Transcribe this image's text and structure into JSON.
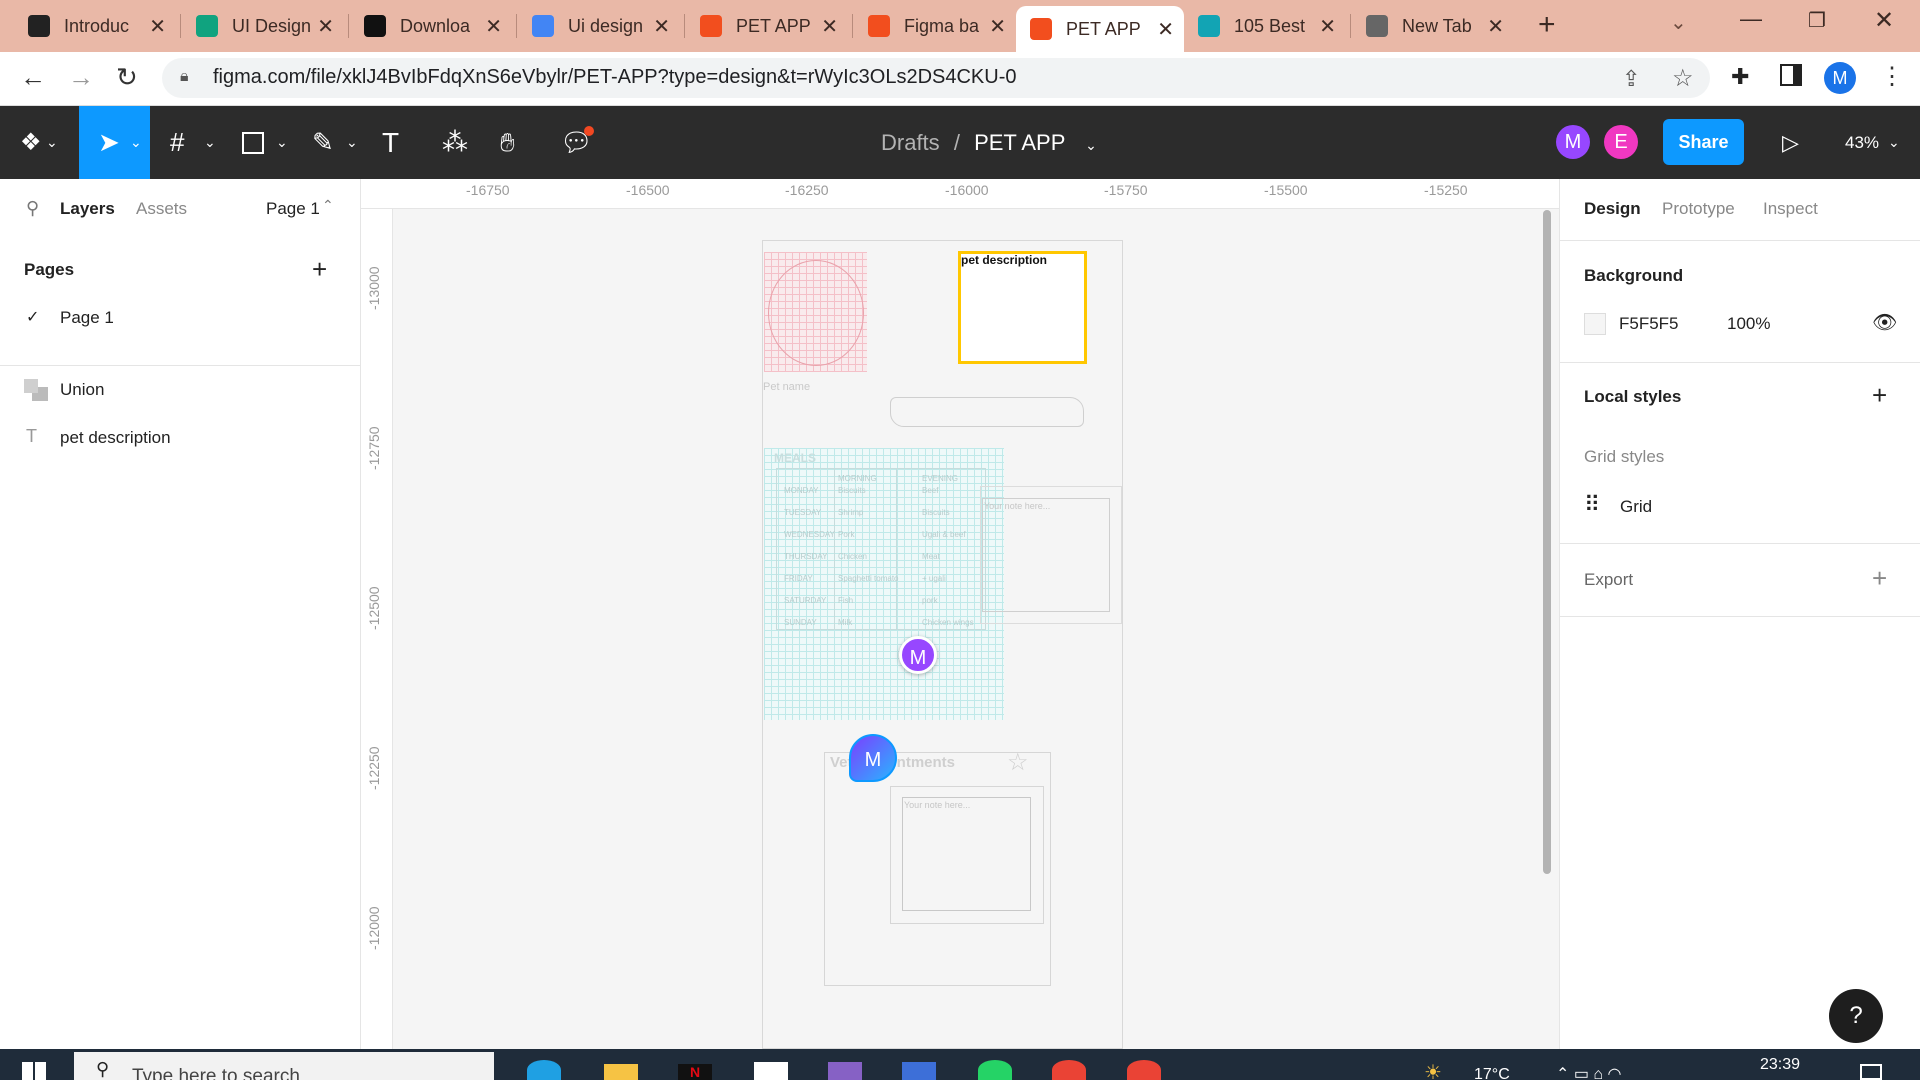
{
  "browser": {
    "tabs": [
      {
        "title": "Introduc",
        "color": "#222"
      },
      {
        "title": "UI Design",
        "color": "#10a37f"
      },
      {
        "title": "Downloa",
        "color": "#111"
      },
      {
        "title": "Ui design",
        "color": "#4285f4"
      },
      {
        "title": "PET APP",
        "color": "#f24e1e"
      },
      {
        "title": "Figma ba",
        "color": "#f24e1e"
      },
      {
        "title": "PET APP",
        "color": "#f24e1e"
      },
      {
        "title": "105 Best",
        "color": "#12a4b4"
      },
      {
        "title": "New Tab",
        "color": "#666"
      }
    ],
    "active_tab": 6,
    "new_tab": "+",
    "url": "figma.com/file/xklJ4BvIbFdqXnS6eVbylr/PET-APP?type=design&t=rWyIc3OLs2DS4CKU-0",
    "profile": "M"
  },
  "toolbar": {
    "breadcrumb_parent": "Drafts",
    "breadcrumb_sep": "/",
    "file_name": "PET APP",
    "share_label": "Share",
    "zoom": "43%",
    "avatars": [
      {
        "letter": "M",
        "color": "#9747ff"
      },
      {
        "letter": "E",
        "color": "#f038c1"
      }
    ]
  },
  "left_panel": {
    "tabs": [
      "Layers",
      "Assets"
    ],
    "page_select": "Page 1",
    "pages_heading": "Pages",
    "pages": [
      "Page 1"
    ],
    "layers": [
      {
        "name": "Union",
        "icon": "union-icon"
      },
      {
        "name": "pet description",
        "icon": "text-icon"
      }
    ]
  },
  "ruler": {
    "top": [
      "-16750",
      "-16500",
      "-16250",
      "-16000",
      "-15750",
      "-15500",
      "-15250"
    ],
    "left": [
      "-13000",
      "-12750",
      "-12500",
      "-12250",
      "-12000"
    ]
  },
  "canvas": {
    "pet_description": "pet description",
    "pet_name": "Pet name",
    "meals": {
      "title": "MEALS",
      "headers": [
        "MORNING",
        "EVENING"
      ],
      "rows": [
        [
          "MONDAY",
          "Biscuits",
          "Beef"
        ],
        [
          "TUESDAY",
          "Shrimp",
          "Biscuits"
        ],
        [
          "WEDNESDAY",
          "Pork",
          "Ugali & beef"
        ],
        [
          "THURSDAY",
          "Chicken",
          "Meat"
        ],
        [
          "FRIDAY",
          "Spaghetti tomato",
          "+ ugali"
        ],
        [
          "SATURDAY",
          "Fish",
          "pork"
        ],
        [
          "SUNDAY",
          "Milk",
          "Chicken wings"
        ]
      ]
    },
    "note_placeholder": "Your note here...",
    "vet_title": "Vet appointments",
    "cursor_avatars": [
      "M",
      "M"
    ]
  },
  "right_panel": {
    "tabs": [
      "Design",
      "Prototype",
      "Inspect"
    ],
    "background_heading": "Background",
    "bg_hex": "F5F5F5",
    "bg_opacity": "100%",
    "local_styles": "Local styles",
    "grid_styles": "Grid styles",
    "grid_name": "Grid",
    "export": "Export",
    "help": "?"
  },
  "taskbar": {
    "search": "Type here to search",
    "weather": "17°C",
    "time": "23:39"
  }
}
